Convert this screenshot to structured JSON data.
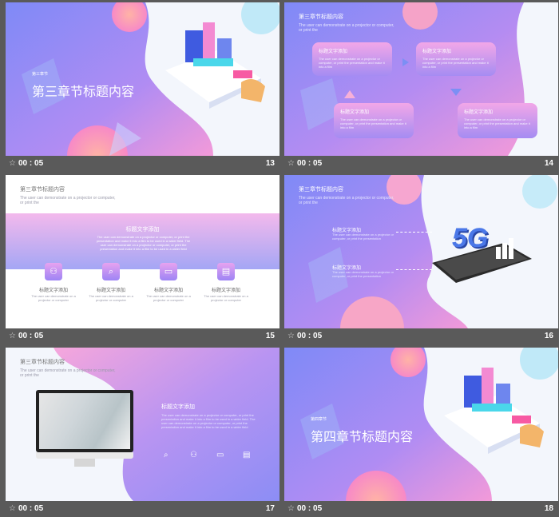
{
  "colors": {
    "bg": "#5a5a5a",
    "accent_blue": "#7b8cf5",
    "accent_pink": "#f08ad8"
  },
  "slides": [
    {
      "id": "13",
      "time": "00 : 05",
      "number": "13",
      "chapter_tag": "第三章节",
      "title": "第三章节标题内容"
    },
    {
      "id": "14",
      "time": "00 : 05",
      "number": "14",
      "header": "第三章节标题内容",
      "sub": "The user can demonstrate on a projector or computer, or print the",
      "boxes": [
        {
          "title": "标题文字添加",
          "text": "The user can demonstrate on a projector or computer, or print the presentation and make it into a film"
        },
        {
          "title": "标题文字添加",
          "text": "The user can demonstrate on a projector or computer, or print the presentation and make it into a film"
        },
        {
          "title": "标题文字添加",
          "text": "The user can demonstrate on a projector or computer, or print the presentation and make it into a film"
        },
        {
          "title": "标题文字添加",
          "text": "The user can demonstrate on a projector or computer, or print the presentation and make it into a film"
        }
      ]
    },
    {
      "id": "15",
      "time": "00 : 05",
      "number": "15",
      "header": "第三章节标题内容",
      "sub": "The user can demonstrate on a projector or computer, or print the",
      "band_title": "标题文字添加",
      "band_text": "The user can demonstrate on a projector or computer, or print the presentation and make it into a film to be used in a wider field. The user can demonstrate on a projector or computer, or print the presentation and make it into a film to be used in a wider field",
      "items": [
        {
          "label": "标题文字添加",
          "text": "The user can demonstrate on a projector or computer"
        },
        {
          "label": "标题文字添加",
          "text": "The user can demonstrate on a projector or computer"
        },
        {
          "label": "标题文字添加",
          "text": "The user can demonstrate on a projector or computer"
        },
        {
          "label": "标题文字添加",
          "text": "The user can demonstrate on a projector or computer"
        }
      ]
    },
    {
      "id": "16",
      "time": "00 : 05",
      "number": "16",
      "header": "第三章节标题内容",
      "sub": "The user can demonstrate on a projector or computer, or print the",
      "points": [
        {
          "title": "标题文字添加",
          "text": "The user can demonstrate on a projector or computer, or print the presentation"
        },
        {
          "title": "标题文字添加",
          "text": "The user can demonstrate on a projector or computer, or print the presentation"
        }
      ],
      "badge": "5G"
    },
    {
      "id": "17",
      "time": "00 : 05",
      "number": "17",
      "header": "第三章节标题内容",
      "sub": "The user can demonstrate on a projector or computer, or print the",
      "content_title": "标题文字添加",
      "content_text": "The user can demonstrate on a projector or computer, or print the presentation and make it into a film to be used in a wider field. The user can demonstrate on a projector or computer, or print the presentation and make it into a film to be used in a wider field"
    },
    {
      "id": "18",
      "time": "00 : 05",
      "number": "18",
      "chapter_tag": "第四章节",
      "title": "第四章节标题内容"
    }
  ]
}
